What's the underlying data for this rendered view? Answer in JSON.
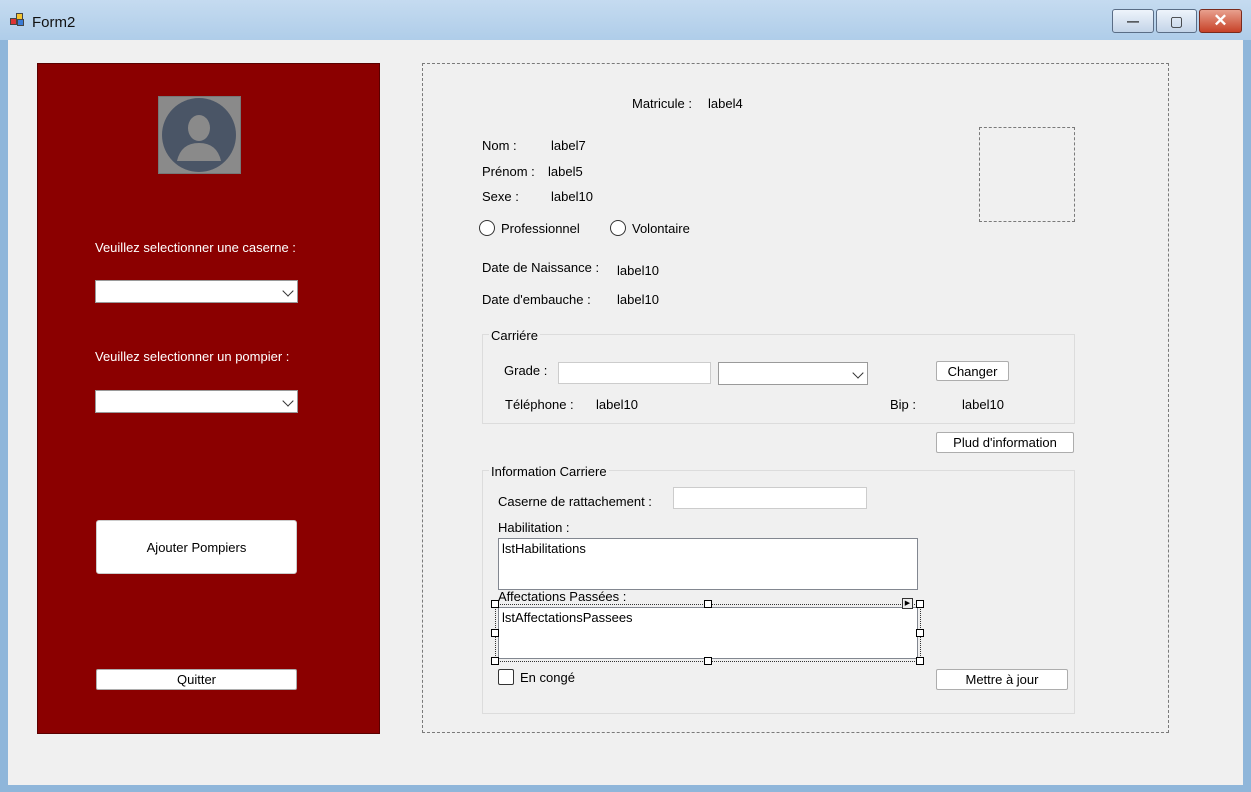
{
  "window": {
    "title": "Form2",
    "controls": {
      "minimize": "—",
      "maximize": "▢",
      "close": "✕"
    }
  },
  "sidebar": {
    "caserne_label": "Veuillez selectionner une caserne :",
    "pompier_label": "Veuillez selectionner un pompier :",
    "caserne_value": "",
    "pompier_value": "",
    "add_button": "Ajouter Pompiers",
    "quit_button": "Quitter"
  },
  "details": {
    "matricule_label": "Matricule :",
    "matricule_value": "label4",
    "nom_label": "Nom :",
    "nom_value": "label7",
    "prenom_label": "Prénom :",
    "prenom_value": "label5",
    "sexe_label": "Sexe :",
    "sexe_value": "label10",
    "radio_professionnel": "Professionnel",
    "radio_volontaire": "Volontaire",
    "naissance_label": "Date de Naissance :",
    "naissance_value": "label10",
    "embauche_label": "Date d'embauche :",
    "embauche_value": "label10"
  },
  "carriere": {
    "title": "Carriére",
    "grade_label": "Grade :",
    "grade_text": "",
    "grade_select": "",
    "change_button": "Changer",
    "telephone_label": "Téléphone :",
    "telephone_value": "label10",
    "bip_label": "Bip :",
    "bip_value": "label10"
  },
  "more_info_button": "Plud d'information",
  "info_carriere": {
    "title": "Information Carriere",
    "caserne_label": "Caserne de rattachement :",
    "caserne_value": "",
    "habilitation_label": "Habilitation :",
    "habilitations_list": "lstHabilitations",
    "affectations_label": "Affectations Passées :",
    "affectations_list": "lstAffectationsPassees",
    "conge_label": "En congé",
    "update_button": "Mettre à jour"
  }
}
